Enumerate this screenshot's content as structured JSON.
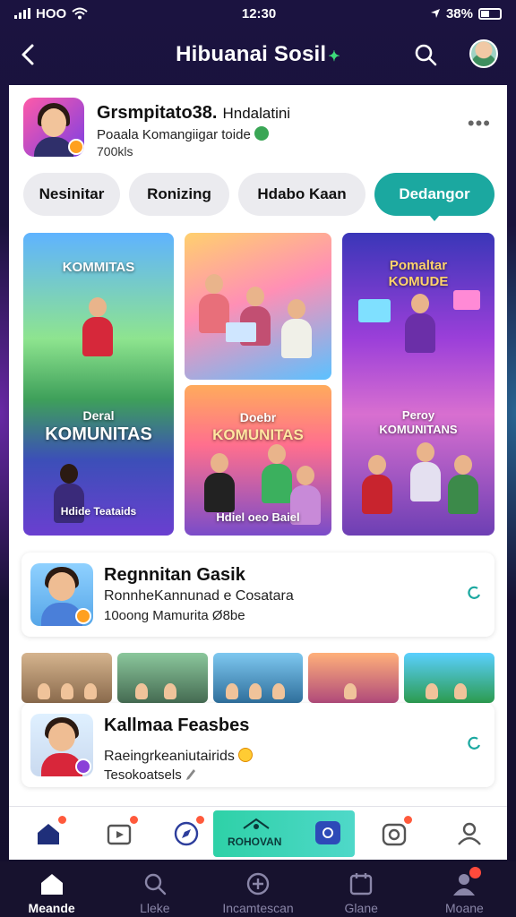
{
  "status_bar": {
    "carrier": "HOO",
    "time": "12:30",
    "battery": "38%"
  },
  "header": {
    "title": "Hibuanai Sosil",
    "title_mark": "✦"
  },
  "group": {
    "name": "Grsmpitato38.",
    "name_suffix": "Hndalatini",
    "description": "Poaala Komangiigar toide",
    "members": "700kls"
  },
  "tabs": [
    {
      "label": "Nesinitar",
      "active": false
    },
    {
      "label": "Ronizing",
      "active": false
    },
    {
      "label": "Hdabo Kaan",
      "active": false
    },
    {
      "label": "Dedangor",
      "active": true
    }
  ],
  "gallery": {
    "tile_a": {
      "caption_top": "KOMMITAS",
      "caption_mid": "Deral",
      "caption_big": "KOMUNITAS",
      "caption_bottom": "Hdide Teataids"
    },
    "tile_c": {
      "caption_top": "Doebr",
      "caption_mid": "KOMUNITAS",
      "caption_bottom": "Hdiel oeo Baiel"
    },
    "tile_d": {
      "caption_top": "Pomaltar",
      "caption_mid": "KOMUDE",
      "caption_low1": "Peroy",
      "caption_low2": "KOMUNITANS"
    }
  },
  "cards": [
    {
      "title": "Regnnitan Gasik",
      "line1": "RonnheKannunad e Cosatara",
      "line2": "10oong Mamurita Ø8be"
    },
    {
      "title": "Kallmaa Feasbes",
      "line1": "Raeingrkeaniutairids",
      "line2": "Tesokoatsels"
    }
  ],
  "inner_nav": {
    "live_label": "ROHOVAN"
  },
  "tab_bar": [
    {
      "label": "Meande",
      "icon": "home-icon",
      "active": true
    },
    {
      "label": "Lleke",
      "icon": "search-icon",
      "active": false
    },
    {
      "label": "Incamtescan",
      "icon": "plus-circle-icon",
      "active": false
    },
    {
      "label": "Glane",
      "icon": "calendar-icon",
      "active": false
    },
    {
      "label": "Moane",
      "icon": "profile-icon",
      "active": false
    }
  ],
  "colors": {
    "accent": "#1ba8a0",
    "background": "#15102e",
    "badge": "#ff5a3c"
  }
}
